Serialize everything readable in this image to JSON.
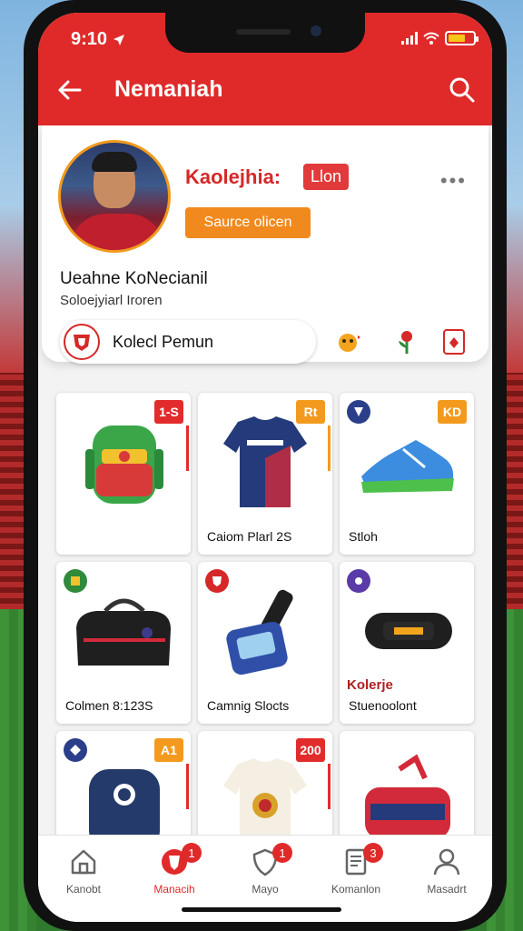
{
  "status": {
    "time": "9:10",
    "time_icon": "location-arrow-icon"
  },
  "header": {
    "title": "Nemaniah",
    "back_icon": "back-arrow-icon",
    "search_icon": "search-icon",
    "color": "#e02a2a"
  },
  "profile": {
    "username": "Kaolejhia:",
    "badge": "Llon",
    "follow_label": "Saurce olicen",
    "full_name": "Ueahne KoNecianil",
    "subtitle": "Soloejyiarl Iroren",
    "collection_label": "Kolecl Pemun",
    "accent": "#f18a1e"
  },
  "products": [
    {
      "tag": "1-S",
      "label": "",
      "icon": "backpack-icon"
    },
    {
      "tag": "Rt",
      "label": "Caiom Plarl 2S",
      "icon": "jersey-icon"
    },
    {
      "tag": "KD",
      "label": "Stloh",
      "icon": "sneaker-icon"
    },
    {
      "tag": "",
      "label": "Colmen 8:123S",
      "icon": "duffel-bag-icon"
    },
    {
      "tag": "",
      "label": "Camnig Slocts",
      "icon": "luggage-tag-icon"
    },
    {
      "tag": "",
      "label_top": "Kolerje",
      "label": "Stuenoolont",
      "icon": "wristband-icon"
    },
    {
      "tag": "A1",
      "label": "",
      "icon": "backpack-navy-icon"
    },
    {
      "tag": "200",
      "label": "",
      "icon": "jersey-white-icon"
    },
    {
      "tag": "",
      "label": "",
      "icon": "sport-bag-icon"
    }
  ],
  "nav": [
    {
      "label": "Kanobt",
      "icon": "home-icon",
      "badge": ""
    },
    {
      "label": "Manacih",
      "icon": "club-crest-icon",
      "badge": "1"
    },
    {
      "label": "Mayo",
      "icon": "shield-icon",
      "badge": "1"
    },
    {
      "label": "Komanlon",
      "icon": "document-icon",
      "badge": "3"
    },
    {
      "label": "Masadrt",
      "icon": "profile-icon",
      "badge": ""
    }
  ]
}
